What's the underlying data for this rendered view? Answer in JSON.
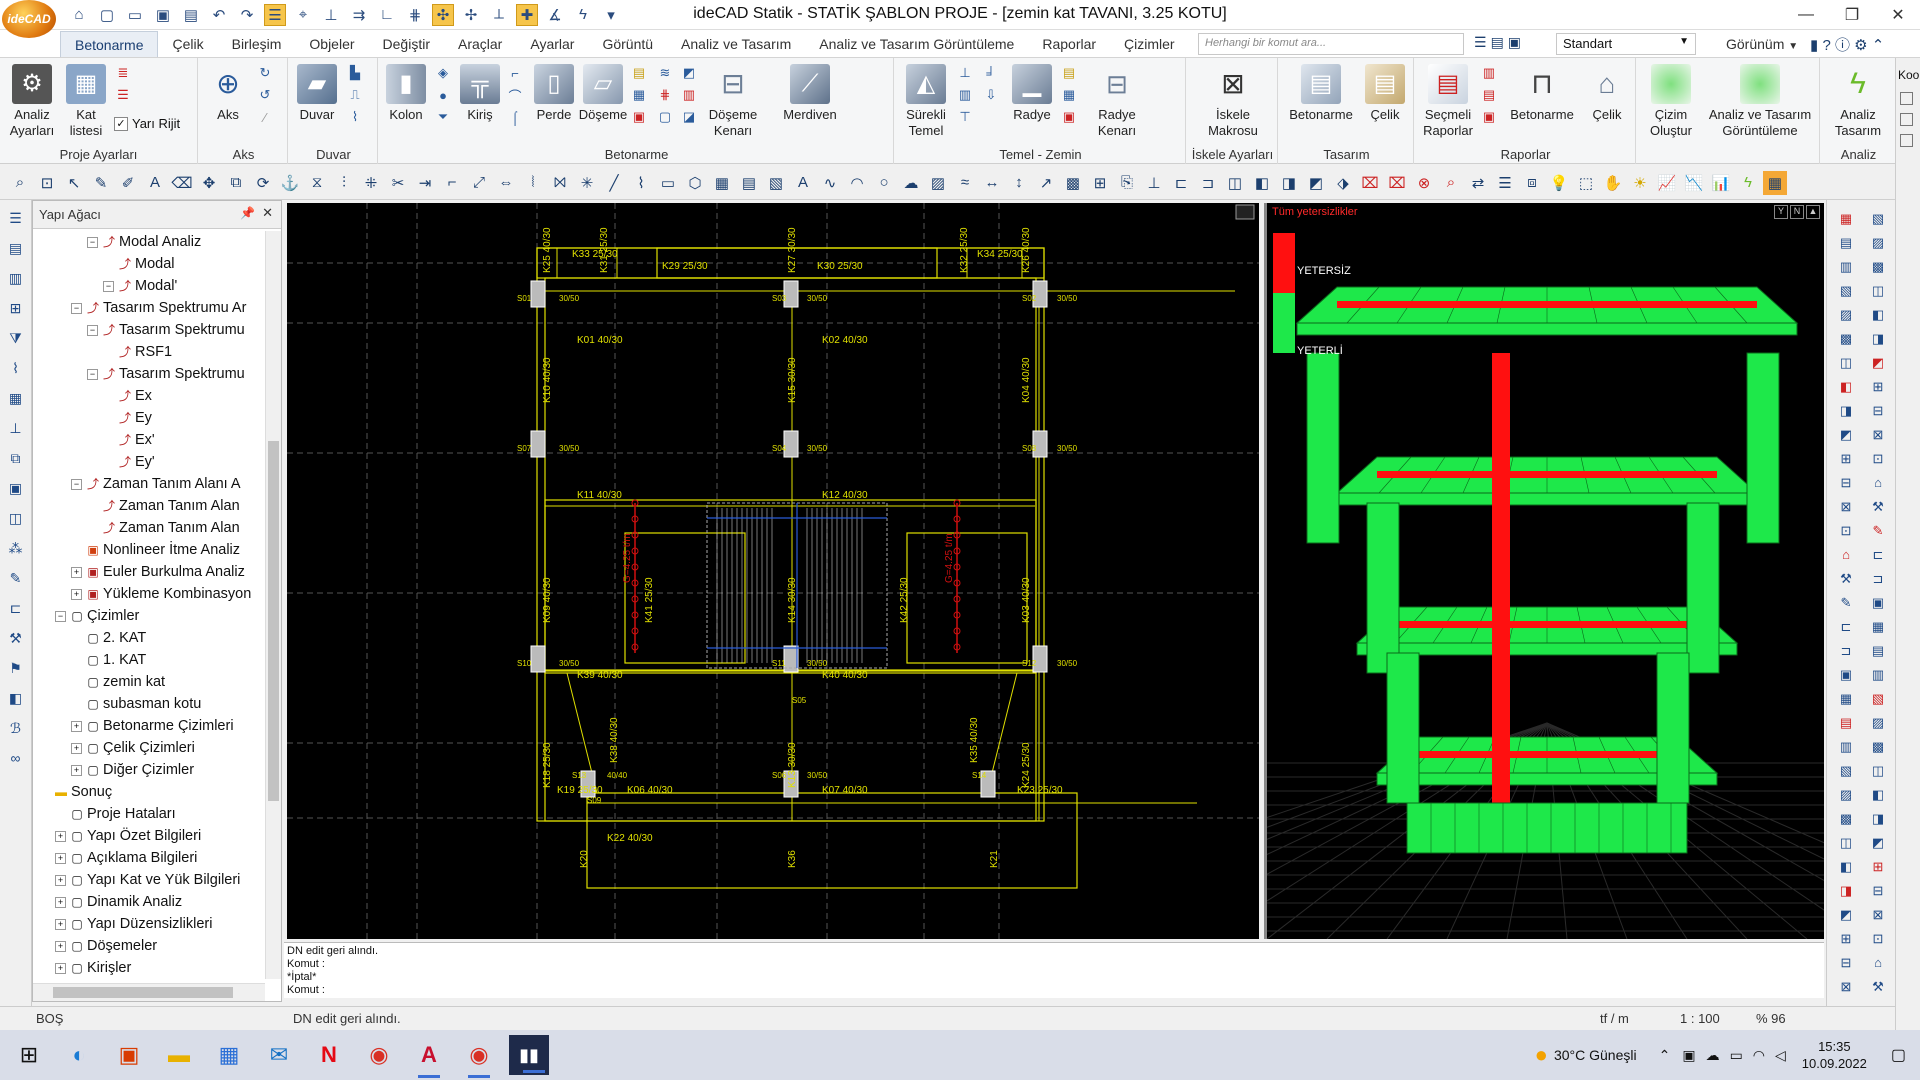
{
  "titlebar": {
    "logo": "ideCAD",
    "title": "ideCAD Statik - STATİK ŞABLON PROJE - [zemin kat TAVANI,  3.25 KOTU]"
  },
  "menu": {
    "tabs": [
      "Betonarme",
      "Çelik",
      "Birleşim",
      "Objeler",
      "Değiştir",
      "Araçlar",
      "Ayarlar",
      "Görüntü",
      "Analiz ve Tasarım",
      "Analiz ve Tasarım Görüntüleme",
      "Raporlar",
      "Çizimler"
    ],
    "active": "Betonarme",
    "search_placeholder": "Herhangi bir komut ara...",
    "style_value": "Standart",
    "view_label": "Görünüm"
  },
  "ribbon": {
    "groups": [
      {
        "label": "Proje Ayarları",
        "buttons": [
          "Analiz Ayarları",
          "Kat listesi"
        ],
        "extra": "Yarı Rijit"
      },
      {
        "label": "Aks",
        "buttons": [
          "Aks"
        ]
      },
      {
        "label": "Duvar",
        "buttons": [
          "Duvar"
        ]
      },
      {
        "label": "Betonarme",
        "buttons": [
          "Kolon",
          "Kiriş",
          "Perde",
          "Döşeme",
          "Döşeme Kenarı",
          "Merdiven"
        ]
      },
      {
        "label": "Temel - Zemin",
        "buttons": [
          "Sürekli Temel",
          "Radye",
          "Radye Kenarı"
        ]
      },
      {
        "label": "İskele Ayarları",
        "buttons": [
          "İskele Makrosu"
        ]
      },
      {
        "label": "Tasarım",
        "buttons": [
          "Betonarme",
          "Çelik"
        ]
      },
      {
        "label": "Raporlar",
        "buttons": [
          "Seçmeli Raporlar",
          "Betonarme",
          "Çelik"
        ]
      },
      {
        "label": "",
        "buttons": [
          "Çizim Oluştur",
          "Analiz ve Tasarım Görüntüleme"
        ]
      },
      {
        "label": "Analiz",
        "buttons": [
          "Analiz Tasarım"
        ]
      }
    ]
  },
  "tree": {
    "header": "Yapı Ağacı",
    "items": [
      {
        "label": "Modal Analiz",
        "level": 3
      },
      {
        "label": "Modal",
        "level": 4
      },
      {
        "label": "Modal'",
        "level": 4
      },
      {
        "label": "Tasarım Spektrumu Ar",
        "level": 2
      },
      {
        "label": "Tasarım Spektrumu",
        "level": 3
      },
      {
        "label": "RSF1",
        "level": 4
      },
      {
        "label": "Tasarım Spektrumu",
        "level": 3
      },
      {
        "label": "Ex",
        "level": 4
      },
      {
        "label": "Ey",
        "level": 4
      },
      {
        "label": "Ex'",
        "level": 4
      },
      {
        "label": "Ey'",
        "level": 4
      },
      {
        "label": "Zaman Tanım Alanı A",
        "level": 2
      },
      {
        "label": "Zaman Tanım Alan",
        "level": 3
      },
      {
        "label": "Zaman Tanım Alan",
        "level": 3
      },
      {
        "label": "Nonlineer İtme Analiz",
        "level": 2
      },
      {
        "label": "Euler Burkulma Analiz",
        "level": 2
      },
      {
        "label": "Yükleme Kombinasyon",
        "level": 2
      },
      {
        "label": "Çizimler",
        "level": 1
      },
      {
        "label": "2. KAT",
        "level": 2
      },
      {
        "label": "1. KAT",
        "level": 2
      },
      {
        "label": "zemin kat",
        "level": 2
      },
      {
        "label": "subasman kotu",
        "level": 2
      },
      {
        "label": "Betonarme Çizimleri",
        "level": 2
      },
      {
        "label": "Çelik Çizimleri",
        "level": 2
      },
      {
        "label": "Diğer Çizimler",
        "level": 2
      },
      {
        "label": "Sonuç",
        "level": 0
      },
      {
        "label": "Proje Hataları",
        "level": 1
      },
      {
        "label": "Yapı Özet Bilgileri",
        "level": 1
      },
      {
        "label": "Açıklama Bilgileri",
        "level": 1
      },
      {
        "label": "Yapı Kat ve Yük Bilgileri",
        "level": 1
      },
      {
        "label": "Dinamik Analiz",
        "level": 1
      },
      {
        "label": "Yapı Düzensizlikleri",
        "level": 1
      },
      {
        "label": "Döşemeler",
        "level": 1
      },
      {
        "label": "Kirişler",
        "level": 1
      }
    ]
  },
  "plan": {
    "beams": [
      "K33 25/30",
      "K29 25/30",
      "K30 25/30",
      "K34 25/30",
      "K01 40/30",
      "K02 40/30",
      "K11 40/30",
      "K12 40/30",
      "K39 40/30",
      "K40 40/30",
      "K06 40/30",
      "K07 40/30",
      "K19 25/30",
      "K23 25/30",
      "K22 40/30"
    ],
    "vbeams": [
      "K25 40/30",
      "K31 25/30",
      "K27 30/30",
      "K32 25/30",
      "K26 40/30",
      "K10 40/30",
      "K15 30/30",
      "K04 40/30",
      "K09 40/30",
      "K41 25/30",
      "K14 30/30",
      "K42 25/30",
      "K03 40/30",
      "K18 25/30",
      "K13 30/30",
      "K24 25/30",
      "K20",
      "K36",
      "K21",
      "K38 40/30",
      "K35 40/30"
    ],
    "columns": [
      "S01",
      "S03",
      "S02",
      "S07",
      "S04",
      "S08",
      "S10",
      "S11",
      "S12",
      "S13",
      "S06",
      "S14",
      "S05",
      "S09"
    ],
    "colsizes": [
      "30/50",
      "30/50",
      "30/50",
      "30/50",
      "30/50",
      "30/50",
      "30/50",
      "30/50",
      "30/50",
      "40/40",
      "30/50"
    ],
    "walls": [
      "G=4.25 t/m",
      "G=4.25 t/m"
    ]
  },
  "view3d": {
    "title": "Tüm yetersizlikler",
    "legend_red": "YETERSİZ",
    "legend_green": "YETERLİ",
    "colors": {
      "insufficient": "#ff1010",
      "sufficient": "#1ee84a"
    }
  },
  "command": {
    "lines": [
      "DN edit geri alındı.",
      "Komut :",
      "*İptal*",
      "Komut :"
    ]
  },
  "status": {
    "left": "BOŞ",
    "message": "DN edit geri alındı.",
    "unit": "tf / m",
    "scale": "1 : 100",
    "zoom": "% 96"
  },
  "taskbar": {
    "weather": "30°C  Güneşli",
    "time": "15:35",
    "date": "10.09.2022"
  }
}
